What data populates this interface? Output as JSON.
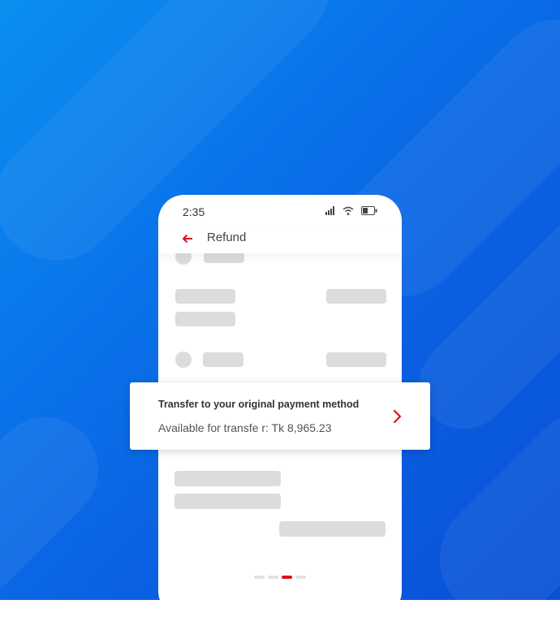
{
  "status_bar": {
    "time": "2:35",
    "icons": [
      "signal-icon",
      "wifi-icon",
      "battery-icon"
    ]
  },
  "header": {
    "back_icon": "arrow-left-icon",
    "title": "Refund"
  },
  "refund_option": {
    "title": "Transfer to your original payment method",
    "subtitle": "Available for transfe r: Tk 8,965.23",
    "icon": "chevron-right-icon"
  },
  "pagination": {
    "total": 4,
    "active_index": 2
  },
  "colors": {
    "accent": "#d8151b",
    "background_blue": "#0a73ea",
    "skeleton": "#dcdcdc"
  }
}
